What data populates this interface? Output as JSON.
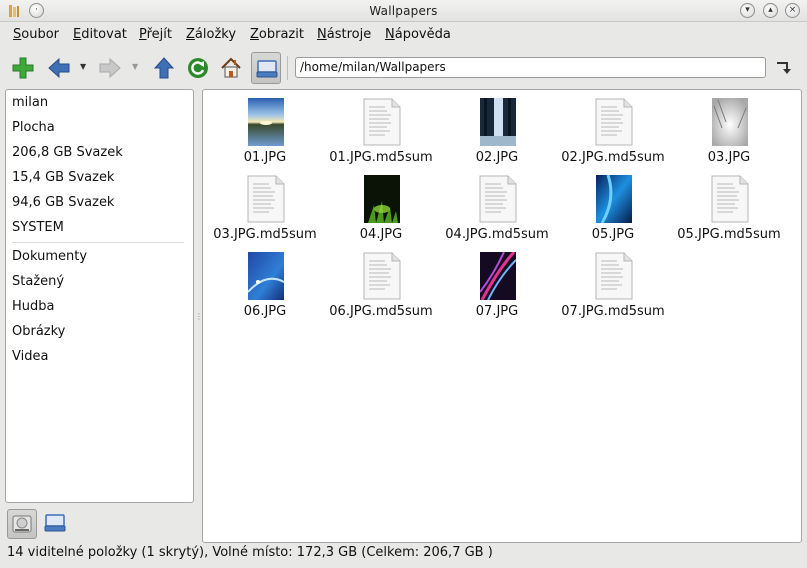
{
  "window": {
    "title": "Wallpapers"
  },
  "menu": [
    {
      "u": "S",
      "rest": "oubor"
    },
    {
      "u": "E",
      "rest": "ditovat"
    },
    {
      "u": "P",
      "rest": "řejít"
    },
    {
      "u": "Z",
      "rest": "áložky"
    },
    {
      "u": "Z",
      "rest": "obrazit"
    },
    {
      "u": "N",
      "rest": "ástroje"
    },
    {
      "u": "N",
      "rest": "ápověda"
    }
  ],
  "location": {
    "path": "/home/milan/Wallpapers"
  },
  "sidebar": {
    "devices": [
      "milan",
      "Plocha",
      "206,8 GB Svazek",
      "15,4 GB Svazek",
      "94,6 GB Svazek",
      "SYSTEM"
    ],
    "bookmarks": [
      "Dokumenty",
      "Stažený",
      "Hudba",
      "Obrázky",
      "Videa"
    ]
  },
  "files": [
    {
      "name": "01.JPG",
      "kind": "image",
      "style": "lake"
    },
    {
      "name": "01.JPG.md5sum",
      "kind": "document"
    },
    {
      "name": "02.JPG",
      "kind": "image",
      "style": "forest"
    },
    {
      "name": "02.JPG.md5sum",
      "kind": "document"
    },
    {
      "name": "03.JPG",
      "kind": "image",
      "style": "snow"
    },
    {
      "name": "03.JPG.md5sum",
      "kind": "document"
    },
    {
      "name": "04.JPG",
      "kind": "image",
      "style": "grass"
    },
    {
      "name": "04.JPG.md5sum",
      "kind": "document"
    },
    {
      "name": "05.JPG",
      "kind": "image",
      "style": "bluewave"
    },
    {
      "name": "05.JPG.md5sum",
      "kind": "document"
    },
    {
      "name": "06.JPG",
      "kind": "image",
      "style": "bluelight"
    },
    {
      "name": "06.JPG.md5sum",
      "kind": "document"
    },
    {
      "name": "07.JPG",
      "kind": "image",
      "style": "pinkstreak"
    },
    {
      "name": "07.JPG.md5sum",
      "kind": "document"
    }
  ],
  "status": {
    "text": "14 viditelné položky (1 skrytý), Volné místo: 172,3 GB (Celkem: 206,7 GB )"
  }
}
